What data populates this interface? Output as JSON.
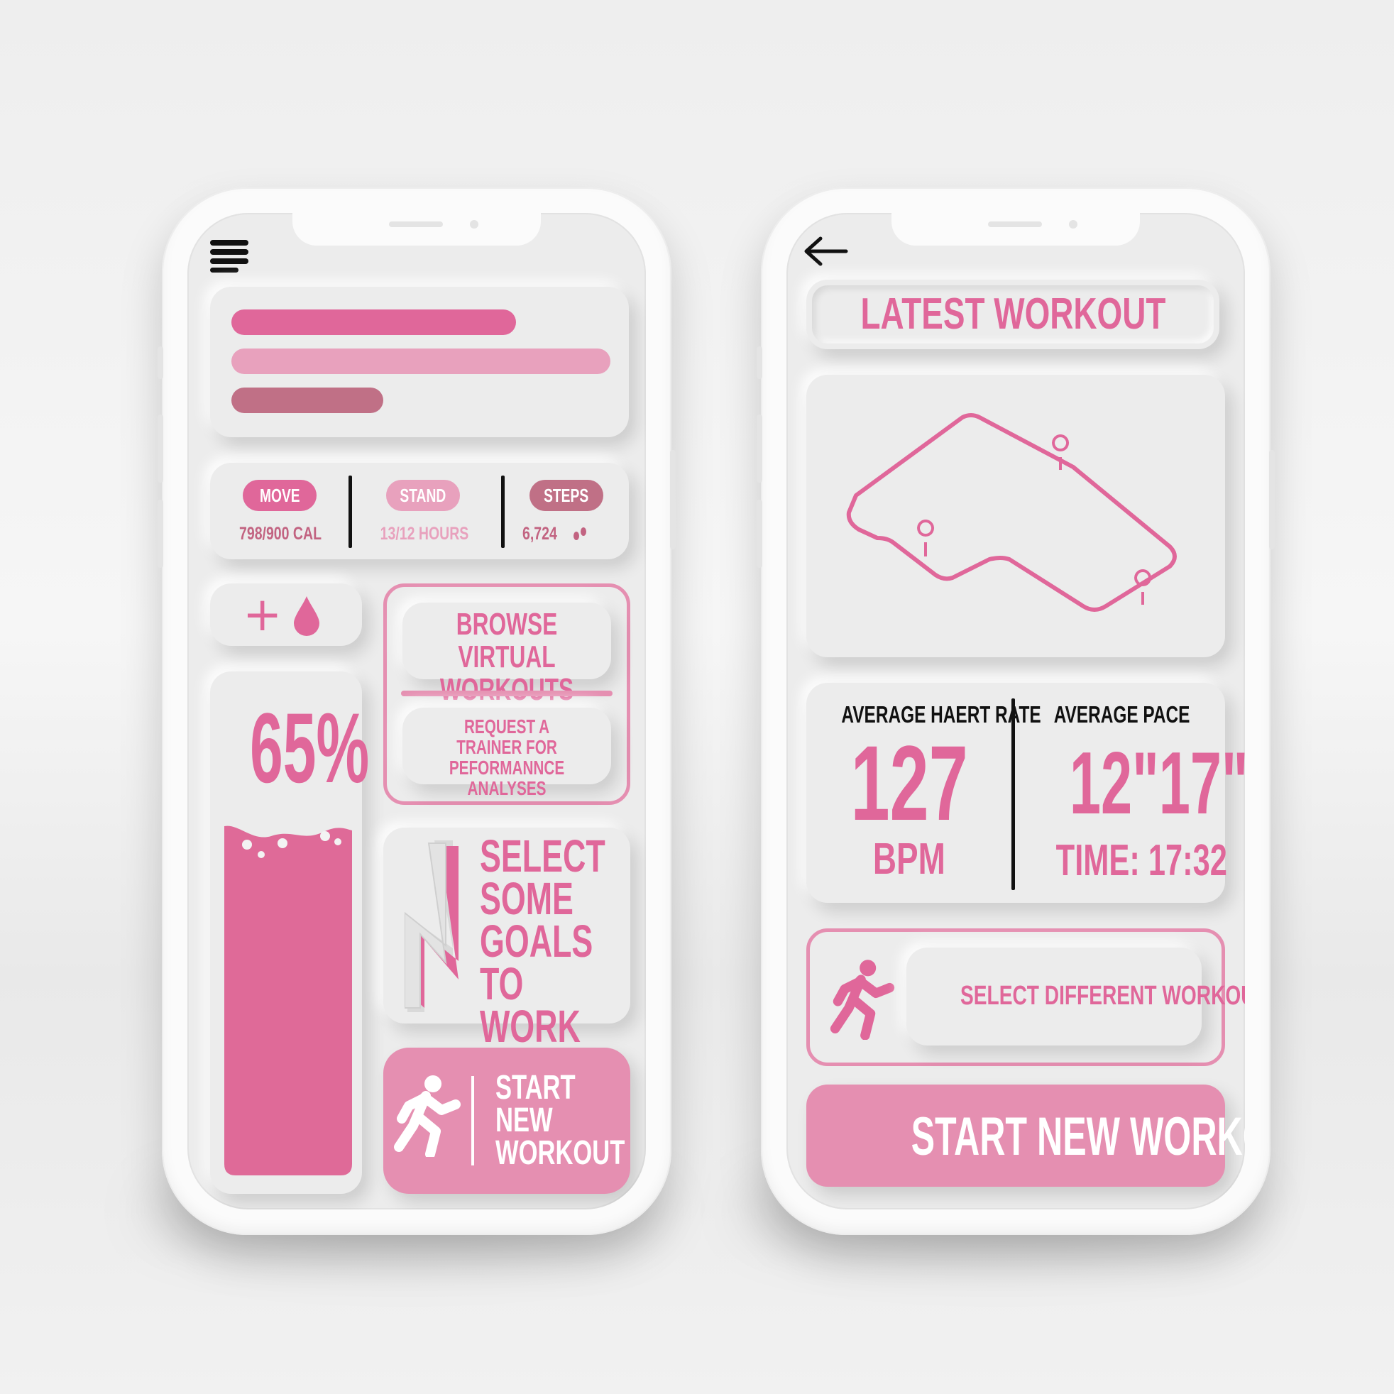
{
  "colors": {
    "pink": "#e0679a",
    "pink_light": "#e8a1bd",
    "pink_dark": "#c07086",
    "button_pink": "#e58fb1",
    "text_dark": "#111111"
  },
  "left": {
    "menu_icon": "menu-icon",
    "activity_bars": [
      {
        "fraction": 0.75,
        "color": "#e0679a"
      },
      {
        "fraction": 1.0,
        "color": "#e8a1bd"
      },
      {
        "fraction": 0.4,
        "color": "#c07086"
      }
    ],
    "stats": [
      {
        "label": "MOVE",
        "value": "798/900 CAL",
        "color": "#e0679a"
      },
      {
        "label": "STAND",
        "value": "13/12 HOURS",
        "color": "#e8a1bd"
      },
      {
        "label": "STEPS",
        "value": "6,724",
        "color": "#c07086"
      }
    ],
    "water": {
      "plus": "+",
      "percent": "65%",
      "level": 0.65
    },
    "browse_virtual_workouts": "BROWSE VIRTUAL WORKOUTS",
    "request_trainer": "REQUEST A TRAINER FOR PEFORMANNCE ANALYSES",
    "goals": "SELECT SOME GOALS TO WORK ON",
    "start_new_workout": "START NEW WORKOUT"
  },
  "right": {
    "back_icon": "back-arrow-icon",
    "title": "LATEST WORKOUT",
    "heart_rate": {
      "label": "AVERAGE HAERT RATE",
      "value": "127",
      "unit": "BPM"
    },
    "pace": {
      "label": "AVERAGE PACE",
      "value": "12\"17\"",
      "time": "TIME: 17:32"
    },
    "select_different_workout": "SELECT DIFFERENT WORKOUT",
    "start_new_workout": "START NEW WORKOUT"
  }
}
